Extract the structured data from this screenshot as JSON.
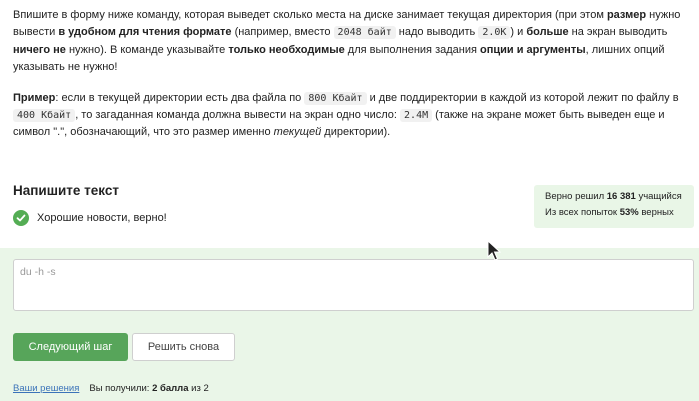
{
  "task": {
    "p1": {
      "t1": "Впишите в форму ниже команду, которая выведет сколько места на диске занимает текущая директория (при этом ",
      "b1": "размер",
      "t2": " нужно вывести ",
      "b2": "в удобном для чтения формате",
      "t3": " (например, вместо ",
      "c1": "2048 байт",
      "t4": " надо выводить ",
      "c2": "2.0K",
      "t5": ") и ",
      "b3": "больше",
      "t6": " на экран выводить ",
      "b4": "ничего не",
      "t7": " нужно). В команде указывайте ",
      "b5": "только необходимые",
      "t8": " для выполнения задания ",
      "b6": "опции и аргументы",
      "t9": ", лишних опций указывать не нужно!"
    },
    "p2": {
      "b1": "Пример",
      "t1": ": если в текущей директории есть два файла по ",
      "c1": "800 Кбайт",
      "t2": " и две поддиректории в каждой из которой лежит по файлу в ",
      "c2": "400 Кбайт",
      "t3": ", то загаданная команда должна вывести на экран одно число: ",
      "c3": "2.4M",
      "t4": " (также на экране может быть выведен еще и символ \".\", обозначающий, что это размер именно ",
      "i1": "текущей",
      "t5": " директории)."
    }
  },
  "write_title": "Напишите текст",
  "feedback": "Хорошие новости, верно!",
  "stats": {
    "line1_pre": "Верно решил ",
    "line1_count": "16 381",
    "line1_post": " учащийся",
    "line2_pre": "Из всех попыток ",
    "line2_pct": "53%",
    "line2_post": " верных"
  },
  "answer": {
    "placeholder": "du -h -s"
  },
  "buttons": {
    "next": "Следующий шаг",
    "again": "Решить снова"
  },
  "footer": {
    "link": "Ваши решения",
    "text_pre": "Вы получили: ",
    "score": "2 балла",
    "text_post": " из 2"
  },
  "colors": {
    "accent": "#57a55a",
    "success_bg": "#eaf6e8",
    "link": "#3b73b9"
  }
}
